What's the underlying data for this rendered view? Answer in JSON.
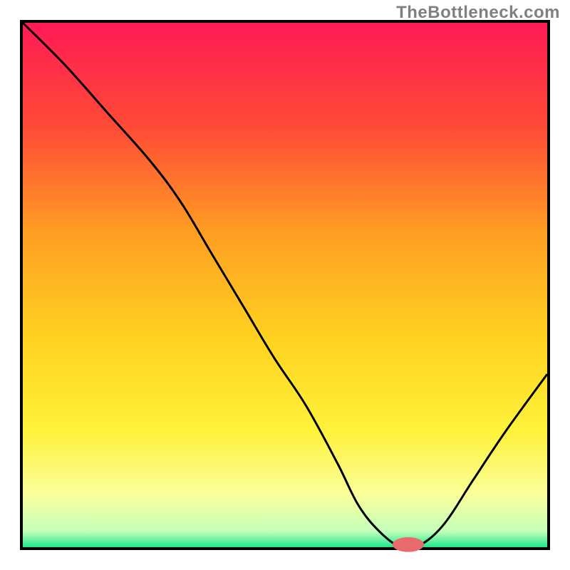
{
  "watermark": "TheBottleneck.com",
  "chart_data": {
    "type": "line",
    "title": "",
    "xlabel": "",
    "ylabel": "",
    "xlim": [
      0,
      100
    ],
    "ylim": [
      0,
      100
    ],
    "grid": false,
    "background_gradient": [
      {
        "offset": 0.0,
        "color": "#ff1a55"
      },
      {
        "offset": 0.2,
        "color": "#ff4b36"
      },
      {
        "offset": 0.4,
        "color": "#ff9e22"
      },
      {
        "offset": 0.6,
        "color": "#ffd21f"
      },
      {
        "offset": 0.78,
        "color": "#fff23b"
      },
      {
        "offset": 0.9,
        "color": "#faff9a"
      },
      {
        "offset": 0.97,
        "color": "#c2ffba"
      },
      {
        "offset": 1.0,
        "color": "#1ee68a"
      }
    ],
    "curve": {
      "x": [
        0,
        8,
        16,
        24,
        30,
        36,
        42,
        48,
        54,
        60,
        64,
        68,
        72,
        75,
        80,
        86,
        92,
        100
      ],
      "y": [
        100,
        92,
        83,
        74,
        66,
        56,
        46,
        36,
        27,
        16,
        8,
        3,
        0,
        0,
        4,
        13,
        22,
        33
      ]
    },
    "marker": {
      "x": 73.5,
      "y": 0.5,
      "rx": 3,
      "ry": 1.4,
      "color": "#e96a6a"
    }
  }
}
